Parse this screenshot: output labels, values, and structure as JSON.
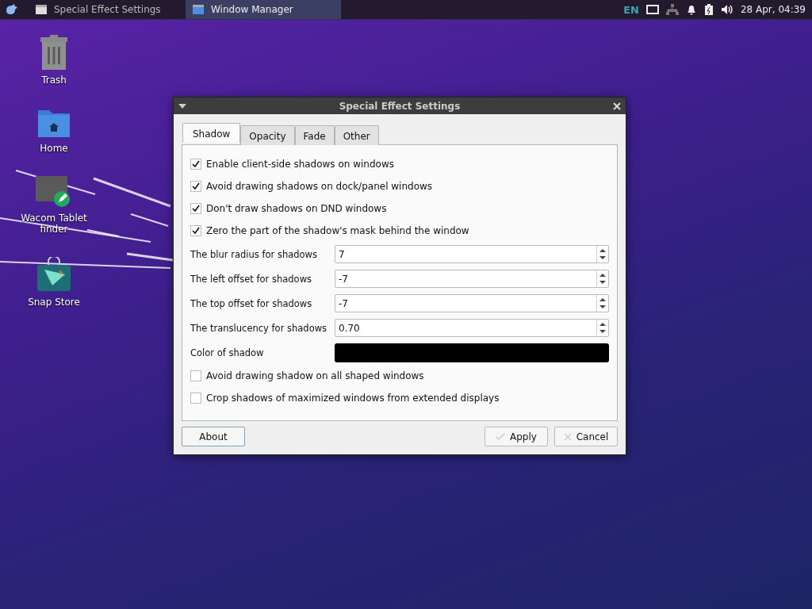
{
  "panel": {
    "tasks": [
      {
        "label": "Special Effect Settings",
        "selected": false
      },
      {
        "label": "Window Manager",
        "selected": true
      }
    ],
    "keyboard_layout": "EN",
    "clock": "28 Apr, 04:39"
  },
  "desktop_icons": [
    {
      "label": "Trash",
      "kind": "trash"
    },
    {
      "label": "Home",
      "kind": "folder"
    },
    {
      "label": "Wacom Tablet finder",
      "kind": "app"
    },
    {
      "label": "Snap Store",
      "kind": "store"
    }
  ],
  "dialog": {
    "title": "Special Effect Settings",
    "tabs": [
      {
        "label": "Shadow",
        "selected": true
      },
      {
        "label": "Opacity",
        "selected": false
      },
      {
        "label": "Fade",
        "selected": false
      },
      {
        "label": "Other",
        "selected": false
      }
    ],
    "settings": [
      {
        "kind": "checkbox",
        "label": "Enable client-side shadows on windows",
        "checked": true
      },
      {
        "kind": "checkbox",
        "label": "Avoid drawing shadows on dock/panel windows",
        "checked": true
      },
      {
        "kind": "checkbox",
        "label": "Don't draw shadows on DND windows",
        "checked": true
      },
      {
        "kind": "checkbox",
        "label": "Zero the part of the shadow's mask behind the window",
        "checked": true
      },
      {
        "kind": "spin",
        "label": "The blur radius for shadows",
        "value": "7"
      },
      {
        "kind": "spin",
        "label": "The left offset for shadows",
        "value": "-7"
      },
      {
        "kind": "spin",
        "label": "The top offset for shadows",
        "value": "-7"
      },
      {
        "kind": "spin",
        "label": "The translucency for shadows",
        "value": "0.70"
      },
      {
        "kind": "color",
        "label": "Color of shadow",
        "color": "#000000"
      },
      {
        "kind": "checkbox",
        "label": "Avoid drawing shadow on all shaped windows",
        "checked": false
      },
      {
        "kind": "checkbox",
        "label": "Crop shadows of maximized windows from extended displays",
        "checked": false
      }
    ],
    "buttons": [
      {
        "label": "About",
        "kind": "about"
      },
      {
        "label": "Apply",
        "kind": "apply"
      },
      {
        "label": "Cancel",
        "kind": "cancel"
      }
    ]
  }
}
